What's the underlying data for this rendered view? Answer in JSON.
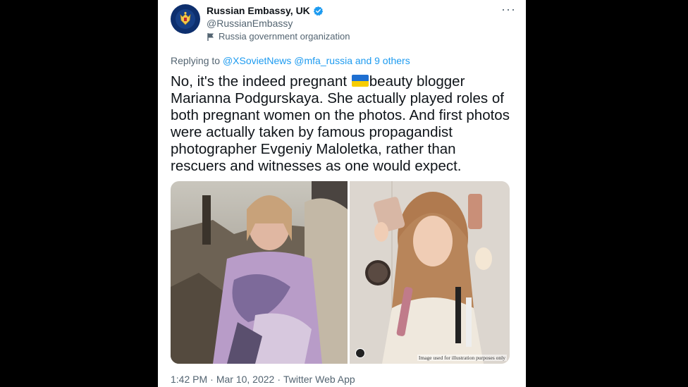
{
  "account": {
    "display_name": "Russian Embassy, UK",
    "handle": "@RussianEmbassy",
    "label": "Russia government organization",
    "verified_icon": "verified-badge-icon",
    "avatar_icon": "coat-of-arms-icon"
  },
  "reply": {
    "prefix": "Replying to",
    "mentions": [
      "@XSovietNews",
      "@mfa_russia"
    ],
    "others": "and 9 others"
  },
  "tweet": {
    "text_before_flag": "No, it's the indeed pregnant ",
    "flag_icon": "ukraine-flag-icon",
    "text_after_flag": "beauty blogger Marianna Podgurskaya. She actually played roles of both pregnant women on the photos. And first photos were actually taken by famous propagandist photographer Evgeniy Maloletka, rather than rescuers and witnesses as one would expect."
  },
  "media": {
    "watermark": "Image used for illustration purposes only"
  },
  "footer": {
    "time": "1:42 PM",
    "sep": "·",
    "date": "Mar 10, 2022",
    "source": "Twitter Web App"
  },
  "colors": {
    "link": "#1d9bf0",
    "muted": "#536471",
    "text": "#0f1419"
  }
}
